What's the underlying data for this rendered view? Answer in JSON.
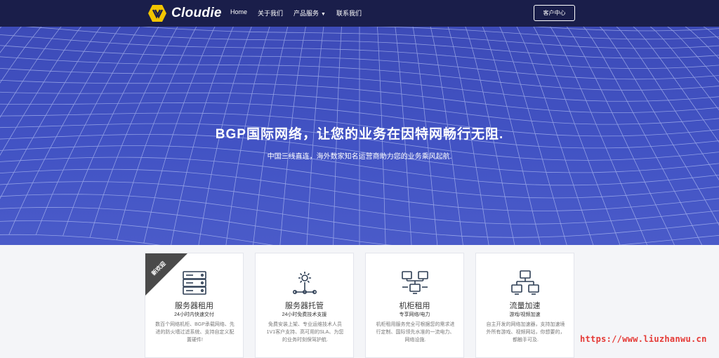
{
  "brand": {
    "name": "Cloudie"
  },
  "nav": {
    "items": [
      {
        "label": "Home"
      },
      {
        "label": "关于我们"
      },
      {
        "label": "产品服务",
        "has_dropdown": true
      },
      {
        "label": "联系我们"
      }
    ],
    "client_button": "客户中心"
  },
  "hero": {
    "title": "BGP国际网络，让您的业务在因特网畅行无阻.",
    "subtitle": "中国三线直连，海外数家知名运营商助力您的业务乘风起航."
  },
  "cards": [
    {
      "title": "服务器租用",
      "subtitle": "24小时内快速交付",
      "desc": "数百个网络机柜、BGP承载网络、先进的防火墙过滤系统、支持自定义配置硬件!",
      "icon": "server-rack-icon",
      "ribbon": "新欢迎"
    },
    {
      "title": "服务器托管",
      "subtitle": "24小时免费技术支援",
      "desc": "免费安装上架、专业运维技术人员1V1客户支持、高可用的SLA、为您的业务时刻保驾护航.",
      "icon": "gear-network-icon"
    },
    {
      "title": "机柜租用",
      "subtitle": "专享网络/电力",
      "desc": "机柜租用服务完全可根据您的需求进行定制、国际领先水准的一流电力、网络设施.",
      "icon": "monitor-network-icon"
    },
    {
      "title": "流量加速",
      "subtitle": "游戏/视频加速",
      "desc": "自主开发的网络加速器，支持加速境外所有游戏、视频网站，你想要的，都触手可及.",
      "icon": "monitor-hierarchy-icon"
    }
  ],
  "watermark": "https://www.liuzhanwu.cn",
  "colors": {
    "navbar": "#1a1e4a",
    "hero": "#4253c4",
    "icon": "#2f3f55",
    "watermark": "#e53935"
  }
}
